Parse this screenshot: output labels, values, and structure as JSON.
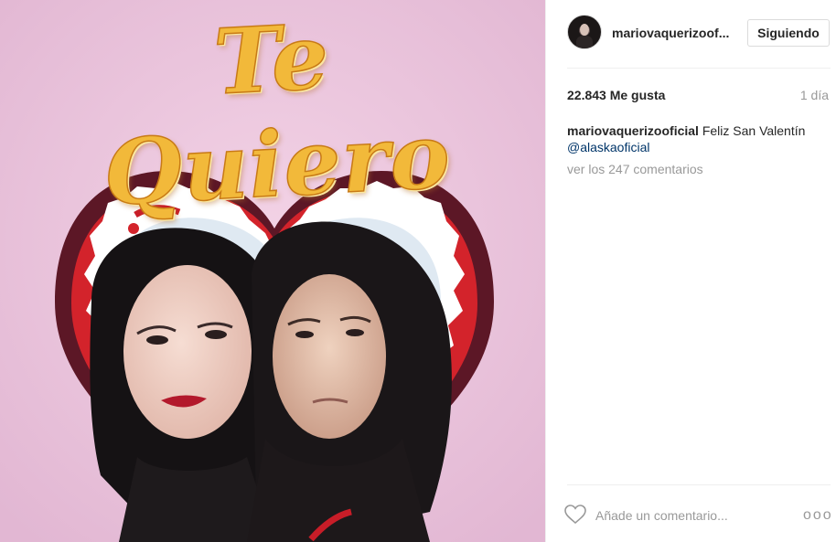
{
  "photo": {
    "title_text": "Te Quiero",
    "background_color": "#ecc6df"
  },
  "header": {
    "username": "mariovaquerizoof...",
    "follow_button": "Siguiendo"
  },
  "stats": {
    "likes_count": "22.843",
    "likes_label": "Me gusta",
    "time_ago": "1 día"
  },
  "caption": {
    "user": "mariovaquerizooficial",
    "text": "Feliz San Valentín",
    "mention": "@alaskaoficial"
  },
  "comments_link": "ver los 247 comentarios",
  "comment_box": {
    "placeholder": "Añade un comentario...",
    "like_icon": "heart-outline-icon",
    "more_icon": "more-options-icon",
    "more_label": "ooo"
  }
}
